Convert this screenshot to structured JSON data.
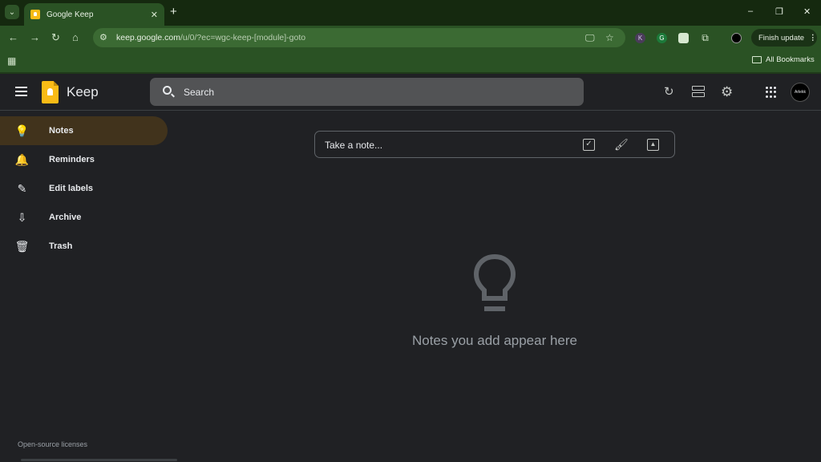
{
  "browser": {
    "tab_title": "Google Keep",
    "tab_close": "✕",
    "new_tab": "+",
    "window_controls": [
      "–",
      "❐",
      "✕"
    ],
    "url_host": "keep.google.com",
    "url_path": "/u/0/?ec=wgc-keep-[module]-goto",
    "extension_badges": [
      "K",
      "G"
    ],
    "finish_update_label": "Finish update",
    "all_bookmarks_label": "All Bookmarks",
    "colors": {
      "tabstrip": "#15290f",
      "toolbar": "#2a5224",
      "omnibox": "#3b6a33"
    }
  },
  "header": {
    "app_name": "Keep",
    "search_placeholder": "Search",
    "avatar_text": "Arlekk",
    "icons": [
      "menu-icon",
      "keep-logo-icon",
      "search-icon",
      "refresh-icon",
      "list-view-icon",
      "settings-icon",
      "apps-icon"
    ]
  },
  "sidebar": {
    "items": [
      {
        "label": "Notes",
        "icon": "lightbulb-icon",
        "glyph": "💡",
        "active": true
      },
      {
        "label": "Reminders",
        "icon": "bell-icon",
        "glyph": "🔔",
        "active": false
      },
      {
        "label": "Edit labels",
        "icon": "pencil-icon",
        "glyph": "✎",
        "active": false
      },
      {
        "label": "Archive",
        "icon": "archive-icon",
        "glyph": "⇩",
        "active": false
      },
      {
        "label": "Trash",
        "icon": "trash-icon",
        "glyph": "🗑",
        "active": false
      }
    ],
    "footer_link": "Open-source licenses",
    "active_color": "#41331c"
  },
  "main": {
    "take_note_placeholder": "Take a note...",
    "take_note_icons": [
      "checkbox-icon",
      "brush-icon",
      "image-icon"
    ],
    "empty_state_text": "Notes you add appear here"
  },
  "theme": {
    "background": "#202124",
    "accent": "#f9bb16"
  }
}
